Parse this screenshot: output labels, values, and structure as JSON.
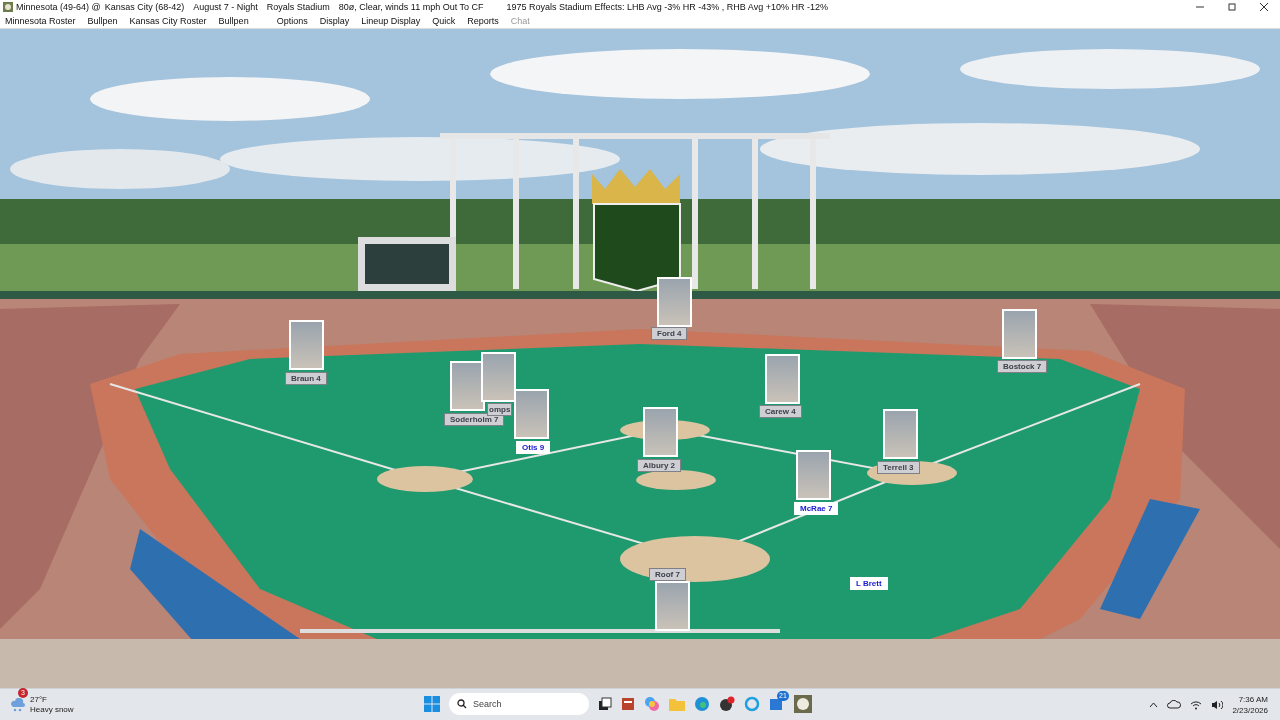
{
  "window": {
    "title_segments": [
      "Minnesota (49-64) @",
      "Kansas City (68-42)",
      "August 7 - Night",
      "Royals Stadium",
      "80ø, Clear, winds 11 mph Out To CF",
      "1975 Royals Stadium Effects: LHB Avg -3%  HR -43% , RHB Avg +10%  HR -12%"
    ]
  },
  "menu": [
    {
      "label": "Minnesota Roster",
      "disabled": false
    },
    {
      "label": "Bullpen",
      "disabled": false
    },
    {
      "label": "Kansas City Roster",
      "disabled": false
    },
    {
      "label": "Bullpen",
      "disabled": false
    },
    {
      "label": "Options",
      "disabled": false
    },
    {
      "label": "Display",
      "disabled": false
    },
    {
      "label": "Lineup Display",
      "disabled": false
    },
    {
      "label": "Quick",
      "disabled": false
    },
    {
      "label": "Reports",
      "disabled": false
    },
    {
      "label": "Chat",
      "disabled": true
    }
  ],
  "players": [
    {
      "label": "Braun 4",
      "kind": "away",
      "photo": true
    },
    {
      "label": "Ford 4",
      "kind": "away",
      "photo": true
    },
    {
      "label": "Bostock 7",
      "kind": "away",
      "photo": true
    },
    {
      "label": "Soderholm 7",
      "kind": "away",
      "photo": true
    },
    {
      "label": "omps",
      "kind": "away",
      "photo": true
    },
    {
      "label": "Otis 9",
      "kind": "home",
      "photo": true
    },
    {
      "label": "Carew 4",
      "kind": "away",
      "photo": true
    },
    {
      "label": "Albury 2",
      "kind": "away",
      "photo": true
    },
    {
      "label": "Terrell 3",
      "kind": "away",
      "photo": true
    },
    {
      "label": "McRae 7",
      "kind": "home",
      "photo": true
    },
    {
      "label": "Roof 7",
      "kind": "away",
      "photo": true
    },
    {
      "label": "L Brett",
      "kind": "home",
      "photo": false
    }
  ],
  "taskbar": {
    "weather": {
      "temperature": "27°F",
      "condition": "Heavy snow",
      "badge": "3"
    },
    "search": {
      "placeholder": "Search"
    },
    "app_badge": "21",
    "time": "7:36 AM",
    "date": "2/23/2026"
  }
}
